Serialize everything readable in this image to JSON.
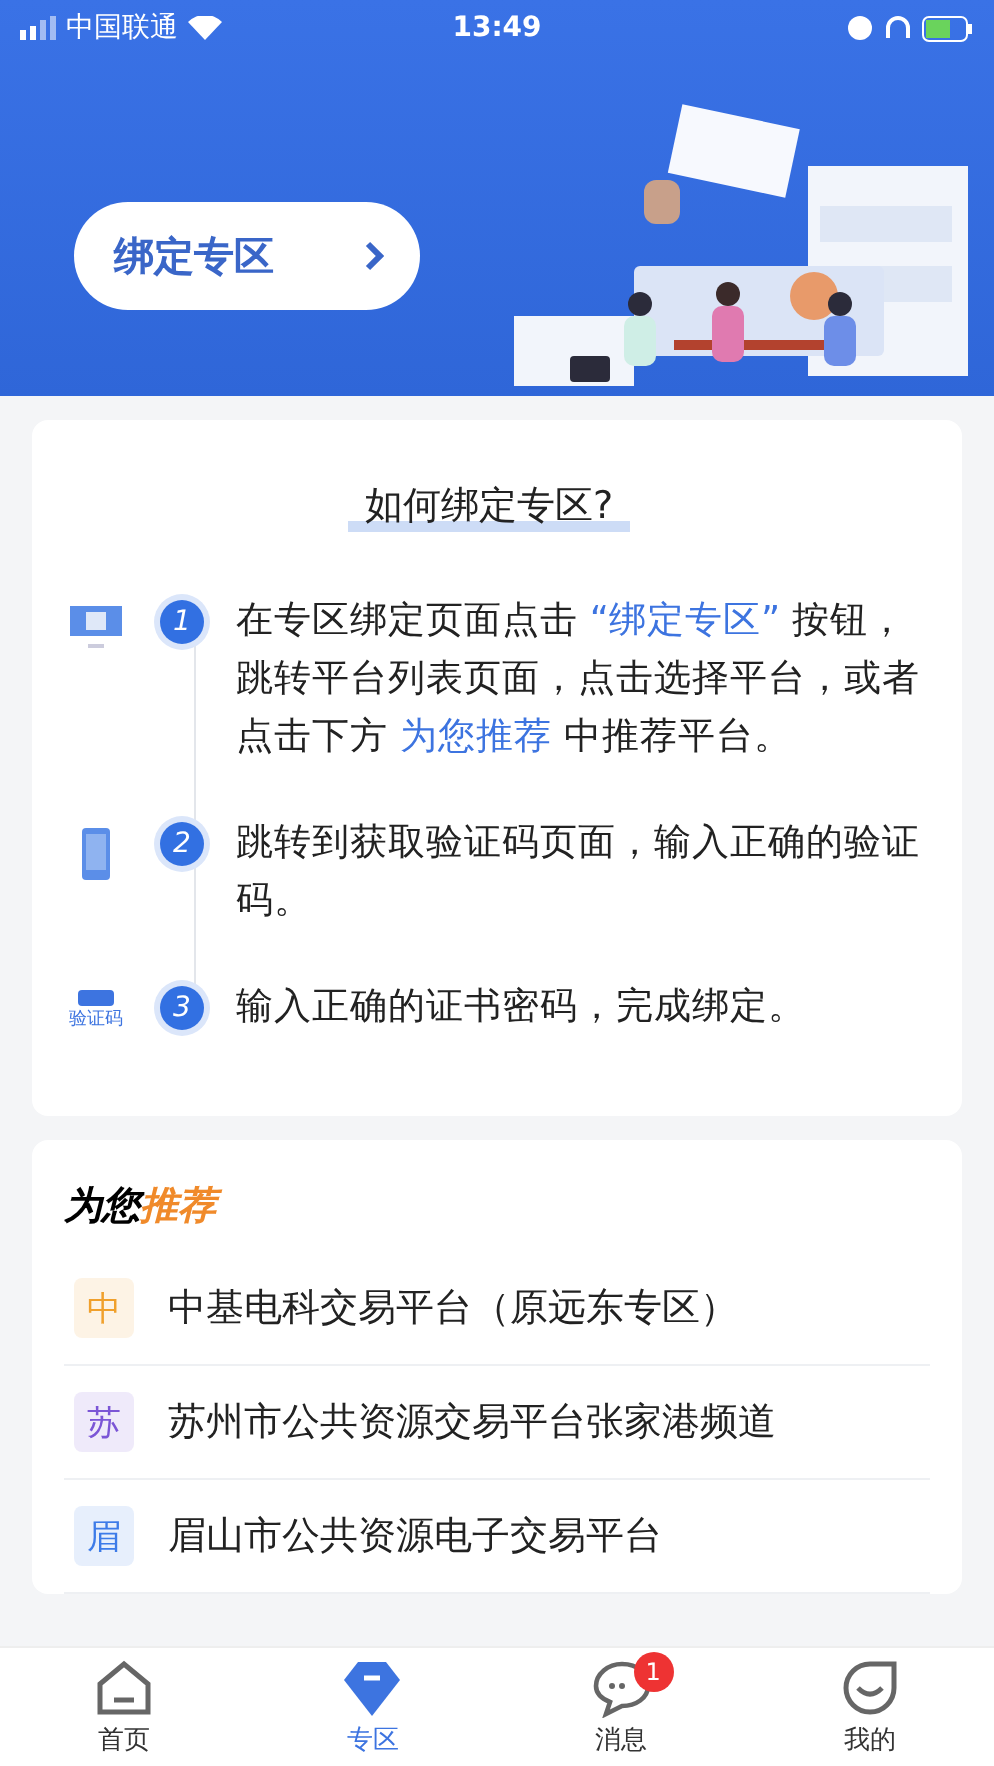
{
  "status_bar": {
    "carrier": "中国联通",
    "time": "13:49"
  },
  "banner": {
    "button_label": "绑定专区"
  },
  "guide": {
    "title": "如何绑定专区?",
    "steps": [
      {
        "number": "1",
        "kind": "monitor",
        "parts": [
          {
            "text": "在专区绑定页面点击 ",
            "highlight": false
          },
          {
            "text": "“绑定专区”",
            "highlight": true
          },
          {
            "text": " 按钮，跳转平台列表页面，点击选择平台，或者点击下方 ",
            "highlight": false
          },
          {
            "text": "为您推荐",
            "highlight": true
          },
          {
            "text": " 中推荐平台。",
            "highlight": false
          }
        ]
      },
      {
        "number": "2",
        "kind": "phone",
        "parts": [
          {
            "text": "跳转到获取验证码页面，输入正确的验证码。",
            "highlight": false
          }
        ]
      },
      {
        "number": "3",
        "kind": "code",
        "icon_label": "验证码",
        "parts": [
          {
            "text": "输入正确的证书密码，完成绑定。",
            "highlight": false
          }
        ]
      }
    ]
  },
  "recommend": {
    "title_plain": "为您",
    "title_accent": "推荐",
    "items": [
      {
        "badge": "中",
        "name": "中基电科交易平台（原远东专区）",
        "color": "#f0a02c"
      },
      {
        "badge": "苏",
        "name": "苏州市公共资源交易平台张家港频道",
        "color": "#7b55d6"
      },
      {
        "badge": "眉",
        "name": "眉山市公共资源电子交易平台",
        "color": "#3d7be8"
      }
    ]
  },
  "tab_bar": [
    {
      "label": "首页",
      "kind": "home",
      "selected": false
    },
    {
      "label": "专区",
      "kind": "diamond",
      "selected": true
    },
    {
      "label": "消息",
      "kind": "chat",
      "selected": false,
      "badge": "1"
    },
    {
      "label": "我的",
      "kind": "smile",
      "selected": false
    }
  ]
}
